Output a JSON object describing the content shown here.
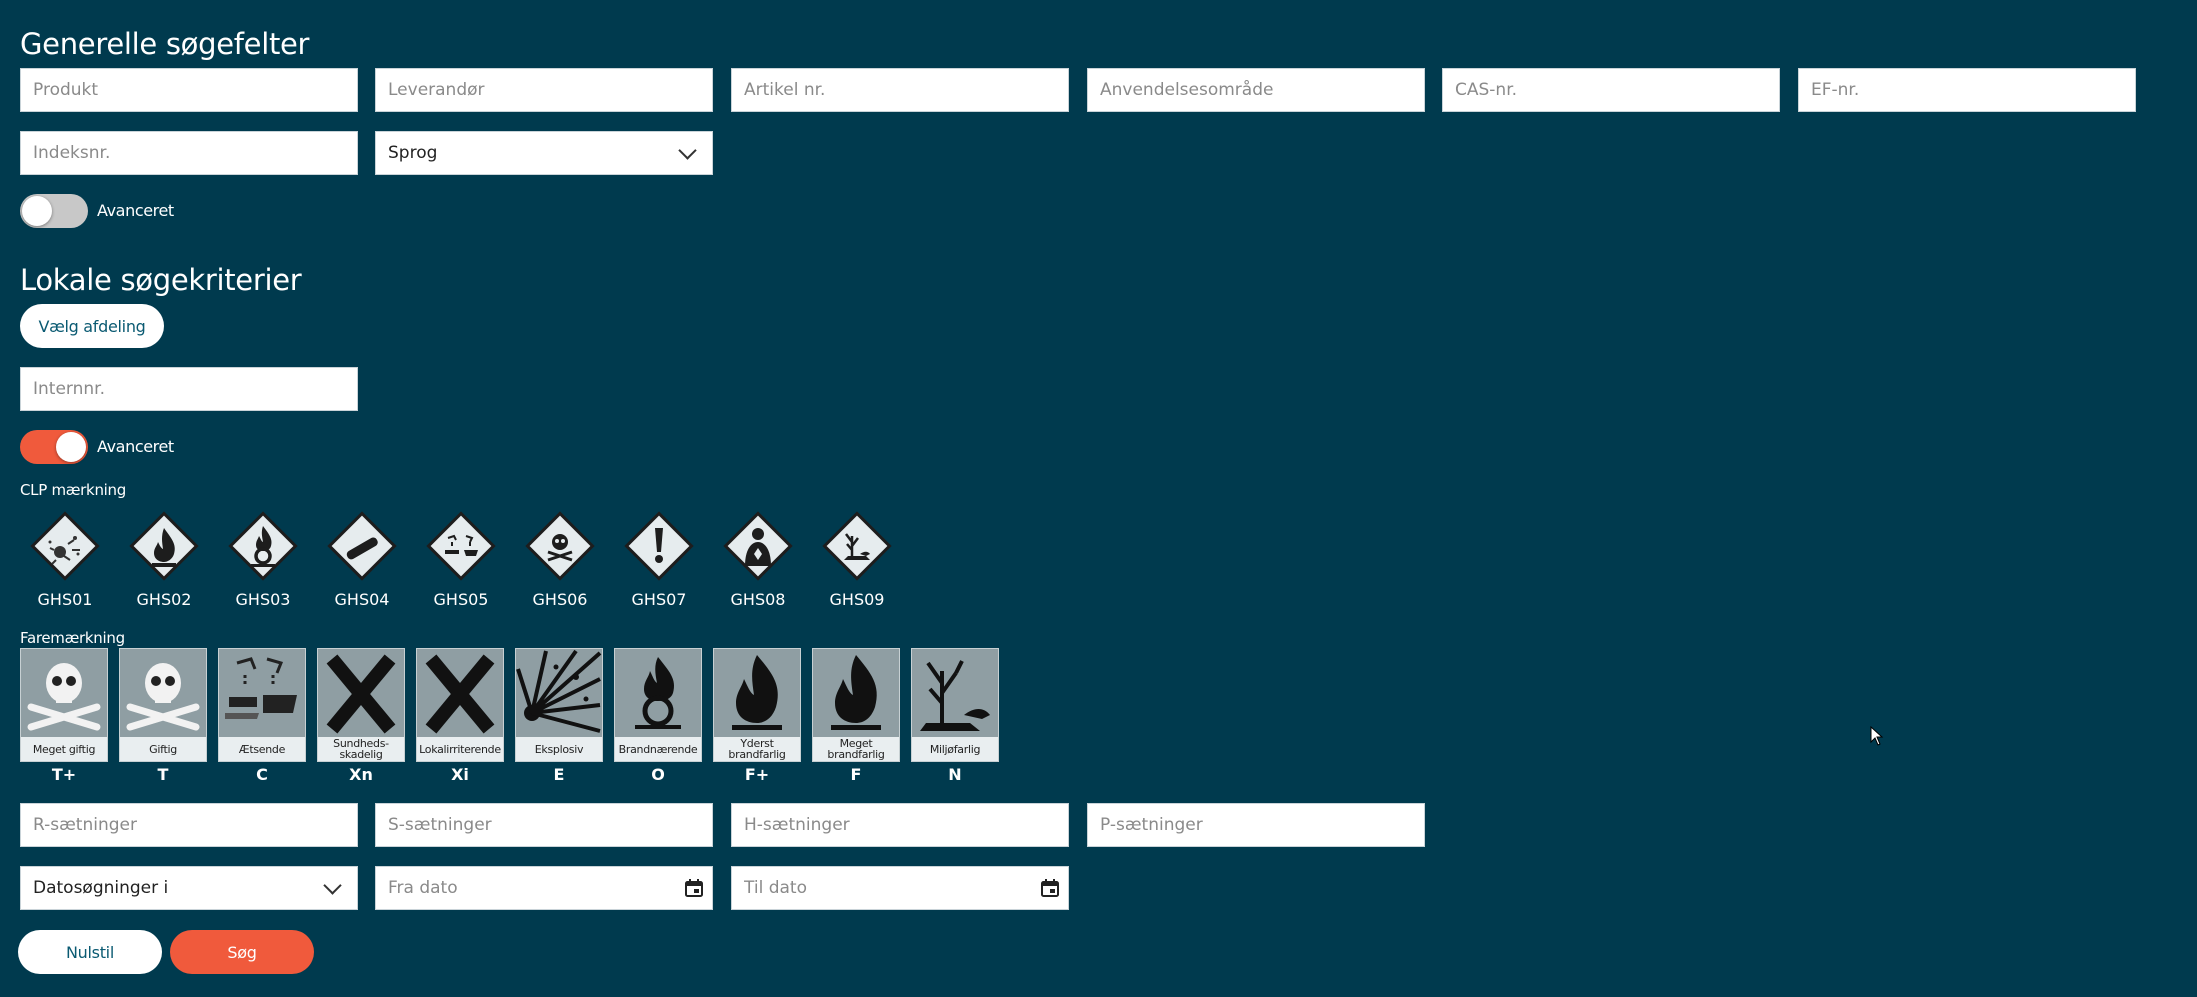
{
  "general": {
    "title": "Generelle søgefelter",
    "fields": [
      "Produkt",
      "Leverandør",
      "Artikel nr.",
      "Anvendelsesområde",
      "CAS-nr.",
      "EF-nr.",
      "Indeksnr."
    ],
    "language_select": "Sprog",
    "advanced_label": "Avanceret"
  },
  "local": {
    "title": "Lokale søgekriterier",
    "choose_department": "Vælg afdeling",
    "internal_no_placeholder": "Internnr.",
    "advanced_label": "Avanceret",
    "clp_label": "CLP mærkning",
    "ghs": [
      {
        "code": "GHS01",
        "icon": "exploding-bomb-icon"
      },
      {
        "code": "GHS02",
        "icon": "flame-icon"
      },
      {
        "code": "GHS03",
        "icon": "flame-over-circle-icon"
      },
      {
        "code": "GHS04",
        "icon": "gas-cylinder-icon"
      },
      {
        "code": "GHS05",
        "icon": "corrosion-icon"
      },
      {
        "code": "GHS06",
        "icon": "skull-crossbones-icon"
      },
      {
        "code": "GHS07",
        "icon": "exclamation-mark-icon"
      },
      {
        "code": "GHS08",
        "icon": "health-hazard-icon"
      },
      {
        "code": "GHS09",
        "icon": "environment-icon"
      }
    ],
    "hazard_label": "Faremærkning",
    "hazards": [
      {
        "label": "Meget giftig",
        "code": "T+",
        "icon": "skull-icon"
      },
      {
        "label": "Giftig",
        "code": "T",
        "icon": "skull-icon"
      },
      {
        "label": "Ætsende",
        "code": "C",
        "icon": "corrosive-icon"
      },
      {
        "label": "Sundheds-skadelig",
        "code": "Xn",
        "icon": "cross-icon"
      },
      {
        "label": "Lokalirriterende",
        "code": "Xi",
        "icon": "cross-icon"
      },
      {
        "label": "Eksplosiv",
        "code": "E",
        "icon": "explosion-icon"
      },
      {
        "label": "Brandnærende",
        "code": "O",
        "icon": "flame-over-circle-icon"
      },
      {
        "label": "Yderst brandfarlig",
        "code": "F+",
        "icon": "flame-icon"
      },
      {
        "label": "Meget brandfarlig",
        "code": "F",
        "icon": "flame-icon"
      },
      {
        "label": "Miljøfarlig",
        "code": "N",
        "icon": "dead-tree-fish-icon"
      }
    ],
    "sentences": [
      "R-sætninger",
      "S-sætninger",
      "H-sætninger",
      "P-sætninger"
    ],
    "date_select": "Datosøgninger i",
    "from_date": "Fra dato",
    "to_date": "Til dato"
  },
  "actions": {
    "reset": "Nulstil",
    "search": "Søg"
  },
  "colors": {
    "background": "#003a4e",
    "accent": "#f05a3c",
    "toggle_off": "#c8c8c8"
  }
}
